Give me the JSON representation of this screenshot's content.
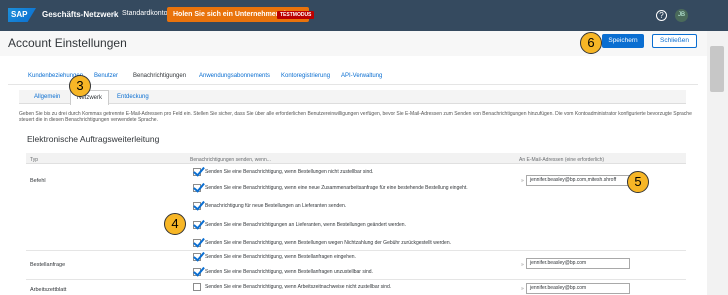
{
  "shell": {
    "logo": "SAP",
    "network": "Geschäfts-Netzwerk",
    "network_chevron": "⌄",
    "account_type": "Standardkonto",
    "upgrade_button": "Holen Sie sich ein Unternehmenskonto",
    "test_badge": "TESTMODUS",
    "help_icon": "?",
    "avatar": "JB"
  },
  "header": {
    "title": "Account Einstellungen",
    "save_label": "Speichern",
    "close_label": "Schließen"
  },
  "tabs": [
    "Kundenbeziehungen",
    "Benutzer",
    "Benachrichtigungen",
    "Anwendungsabonnements",
    "Kontoregistrierung",
    "API-Verwaltung"
  ],
  "subtabs": [
    "Allgemein",
    "Netzwerk",
    "Entdeckung"
  ],
  "description": "Geben Sie bis zu drei durch Kommas getrennte E-Mail-Adressen pro Feld ein. Stellen Sie sicher, dass Sie über alle erforderlichen Benutzereinwilligungen verfügen, bevor Sie E-Mail-Adressen zum Senden von Benachrichtigungen hinzufügen. Die vom Kontoadministrator konfigurierte bevorzugte Sprache steuert die in diesen Benachrichtigungen verwendete Sprache.",
  "section_title": "Elektronische Auftragsweiterleitung",
  "table": {
    "col_type": "Typ",
    "col_send": "Benachrichtigungen senden, wenn...",
    "col_email": "An E-Mail-Adressen (eine erforderlich)"
  },
  "rows": [
    {
      "type": "Befehl",
      "options": [
        {
          "label": "Senden Sie eine Benachrichtigung, wenn Bestellungen nicht zustellbar sind.",
          "checked": true
        },
        {
          "label": "Senden Sie eine Benachrichtigung, wenn eine neue Zusammenarbeitsanfrage für eine bestehende Bestellung eingeht.",
          "checked": true
        },
        {
          "label": "Benachrichtigung für neue Bestellungen an Lieferanten senden.",
          "checked": true
        },
        {
          "label": "Senden Sie eine Benachrichtigungen an Lieferanten, wenn Bestellungen geändert werden.",
          "checked": true
        },
        {
          "label": "Senden Sie eine Benachrichtigung, wenn Bestellungen wegen Nichtzahlung der Gebühr zurückgestellt werden.",
          "checked": true
        }
      ],
      "email": "jennifer.beasley@bp.com,mitesh.shroff"
    },
    {
      "type": "Bestellanfrage",
      "options": [
        {
          "label": "Senden Sie eine Benachrichtigung, wenn Bestellanfragen eingehen.",
          "checked": true
        },
        {
          "label": "Senden Sie eine Benachrichtigung, wenn Bestellanfragen unzustellbar sind.",
          "checked": true
        }
      ],
      "email": "jennifer.beasley@bp.com"
    },
    {
      "type": "Arbeitszettblatt",
      "options": [
        {
          "label": "Senden Sie eine Benachrichtigung, wenn Arbeitszeitnachweise nicht zustellbar sind.",
          "checked": false
        }
      ],
      "email": "jennifer.beasley@bp.com"
    }
  ],
  "email_marker": "»",
  "callouts": [
    "3",
    "4",
    "5",
    "6"
  ],
  "colors": {
    "shell": "#354a5f",
    "accent": "#0a6ed1",
    "upgrade": "#e9730c",
    "test": "#bb0000",
    "callout": "#f7b626"
  }
}
